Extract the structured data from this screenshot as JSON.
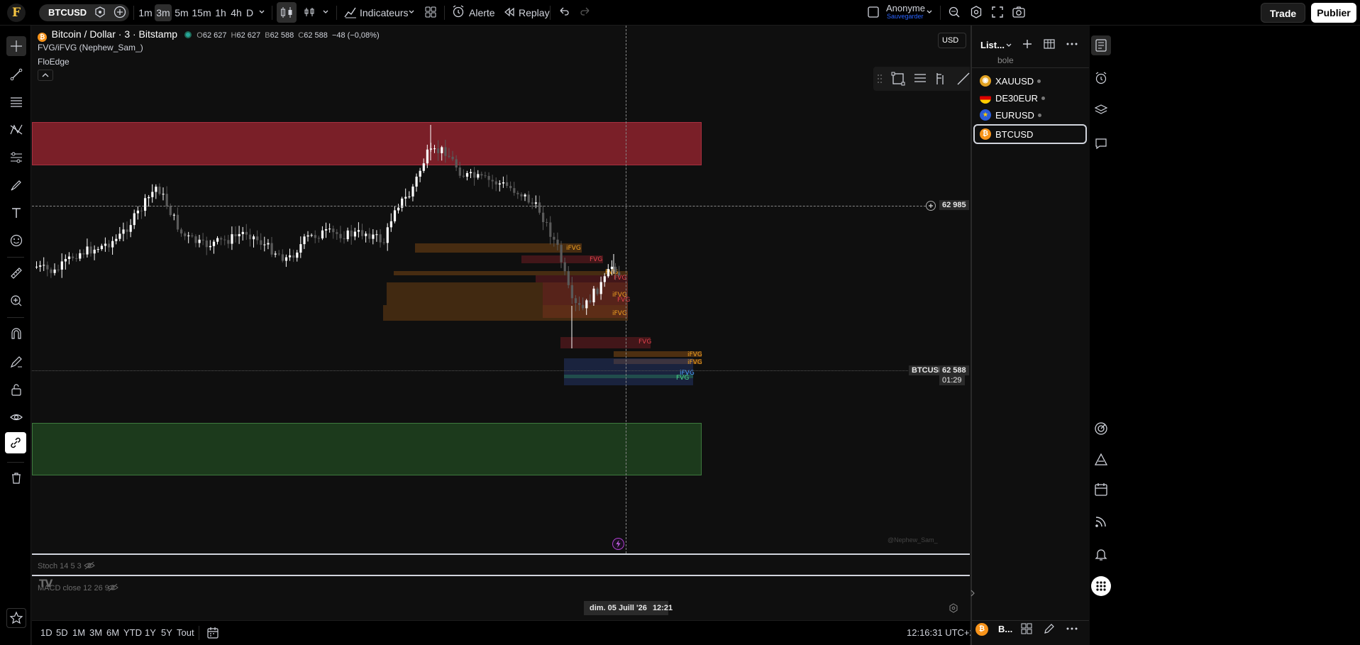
{
  "colors": {
    "bull": "#ffffff",
    "bear": "#5a5a5a",
    "supply_zone": "#7a1f28",
    "demand_zone": "#1c3a1c",
    "fvg_orange": "#f0a020",
    "fvg_red": "#e0414b",
    "fvg_blue": "#4aa3ff",
    "fvg_green": "#4ad68c",
    "brand": "#f5c542"
  },
  "topbar": {
    "logo": "F",
    "symbol": "BTCUSD",
    "timeframes": [
      "1m",
      "3m",
      "5m",
      "15m",
      "1h",
      "4h",
      "D"
    ],
    "active_timeframe": "3m",
    "indicators_label": "Indicateurs",
    "alert_label": "Alerte",
    "replay_label": "Replay",
    "user_name": "Anonyme",
    "save_label": "Sauvegarder",
    "trade_label": "Trade",
    "publish_label": "Publier"
  },
  "chart": {
    "title": "Bitcoin / Dollar · 3 · Bitstamp",
    "ohlc": {
      "o_label": "O",
      "o": "62 627",
      "h_label": "H",
      "h": "62 627",
      "b_label": "B",
      "b": "62 588",
      "c_label": "C",
      "c": "62 588",
      "change": "−48 (−0,08%)"
    },
    "indicator1": "FVG/iFVG (Nephew_Sam_)",
    "indicator2": "FloEdge",
    "currency": "USD",
    "crosshair_price": "62 985",
    "last_symbol": "BTCUSD",
    "last_price": "62 588",
    "countdown": "01:29",
    "crosshair_date": "dim. 05 Juill '26",
    "crosshair_time": "12:21",
    "watermark": "@Nephew_Sam_",
    "pane_stoch": "Stoch 14 5 3",
    "pane_macd": "MACD close 12 26 9",
    "fvg_labels": [
      "iFVG",
      "FVG",
      "FVG",
      "FVG",
      "FVG",
      "iFVG",
      "iFVG",
      "FVG",
      "iFVG",
      "iFVG",
      "iFVG",
      "FVG"
    ]
  },
  "bottombar": {
    "ranges": [
      "1D",
      "5D",
      "1M",
      "3M",
      "6M",
      "YTD",
      "1Y",
      "5Y",
      "Tout"
    ],
    "clock": "12:16:31 UTC+2"
  },
  "watchlist": {
    "title": "List...",
    "search_placeholder": "bole",
    "items": [
      {
        "symbol": "XAUUSD",
        "icon_color": "#e0a020",
        "icon": "coin-gold-icon"
      },
      {
        "symbol": "DE30EUR",
        "icon_color": "#333",
        "icon": "flag-de-icon"
      },
      {
        "symbol": "EURUSD",
        "icon_color": "#2a5bd7",
        "icon": "flag-eu-us-icon"
      },
      {
        "symbol": "BTCUSD",
        "icon_color": "#f7931a",
        "icon": "bitcoin-icon"
      }
    ],
    "footer_symbol": "B..."
  }
}
